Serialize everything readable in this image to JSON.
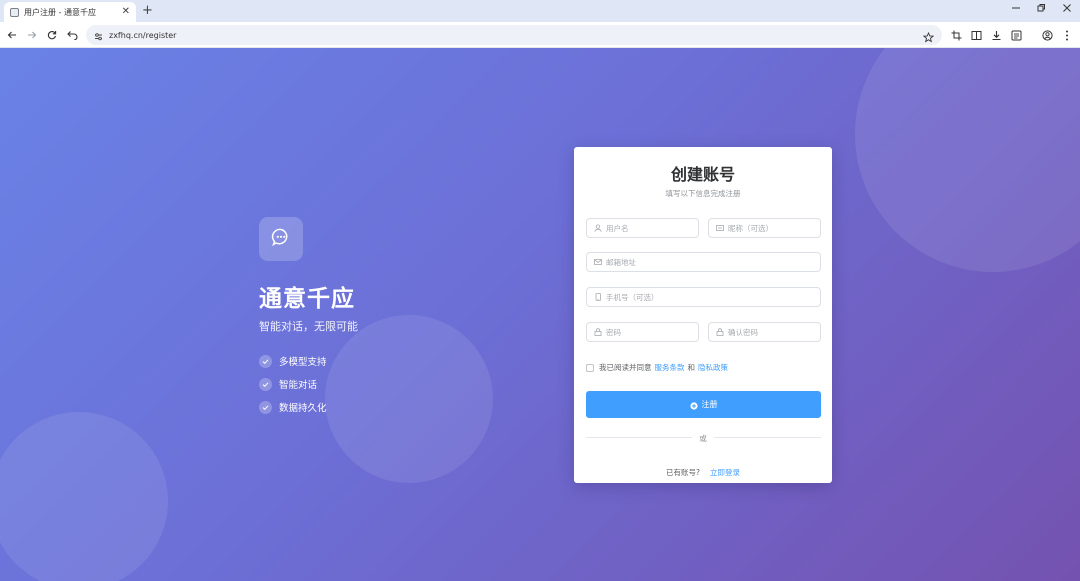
{
  "browser": {
    "tab_title": "用户注册 - 通意千应",
    "url": "zxfhq.cn/register",
    "newtab_symbol": "+",
    "close_symbol": "✕"
  },
  "brand": {
    "name": "通意千应",
    "tagline": "智能对话，无限可能",
    "features": [
      "多模型支持",
      "智能对话",
      "数据持久化"
    ]
  },
  "form": {
    "title": "创建账号",
    "subtitle": "填写以下信息完成注册",
    "username_placeholder": "用户名",
    "nickname_placeholder": "昵称（可选）",
    "email_placeholder": "邮箱地址",
    "phone_placeholder": "手机号（可选）",
    "password_placeholder": "密码",
    "confirm_password_placeholder": "确认密码",
    "agree_prefix": "我已阅读并同意",
    "terms_link": "服务条款",
    "agree_and": "和",
    "privacy_link": "隐私政策",
    "submit_label": "注册",
    "divider_text": "或",
    "have_account": "已有账号?",
    "login_link": "立即登录"
  },
  "colors": {
    "primary": "#409eff",
    "gradient_start": "#6a82e6",
    "gradient_end": "#7452b0"
  }
}
